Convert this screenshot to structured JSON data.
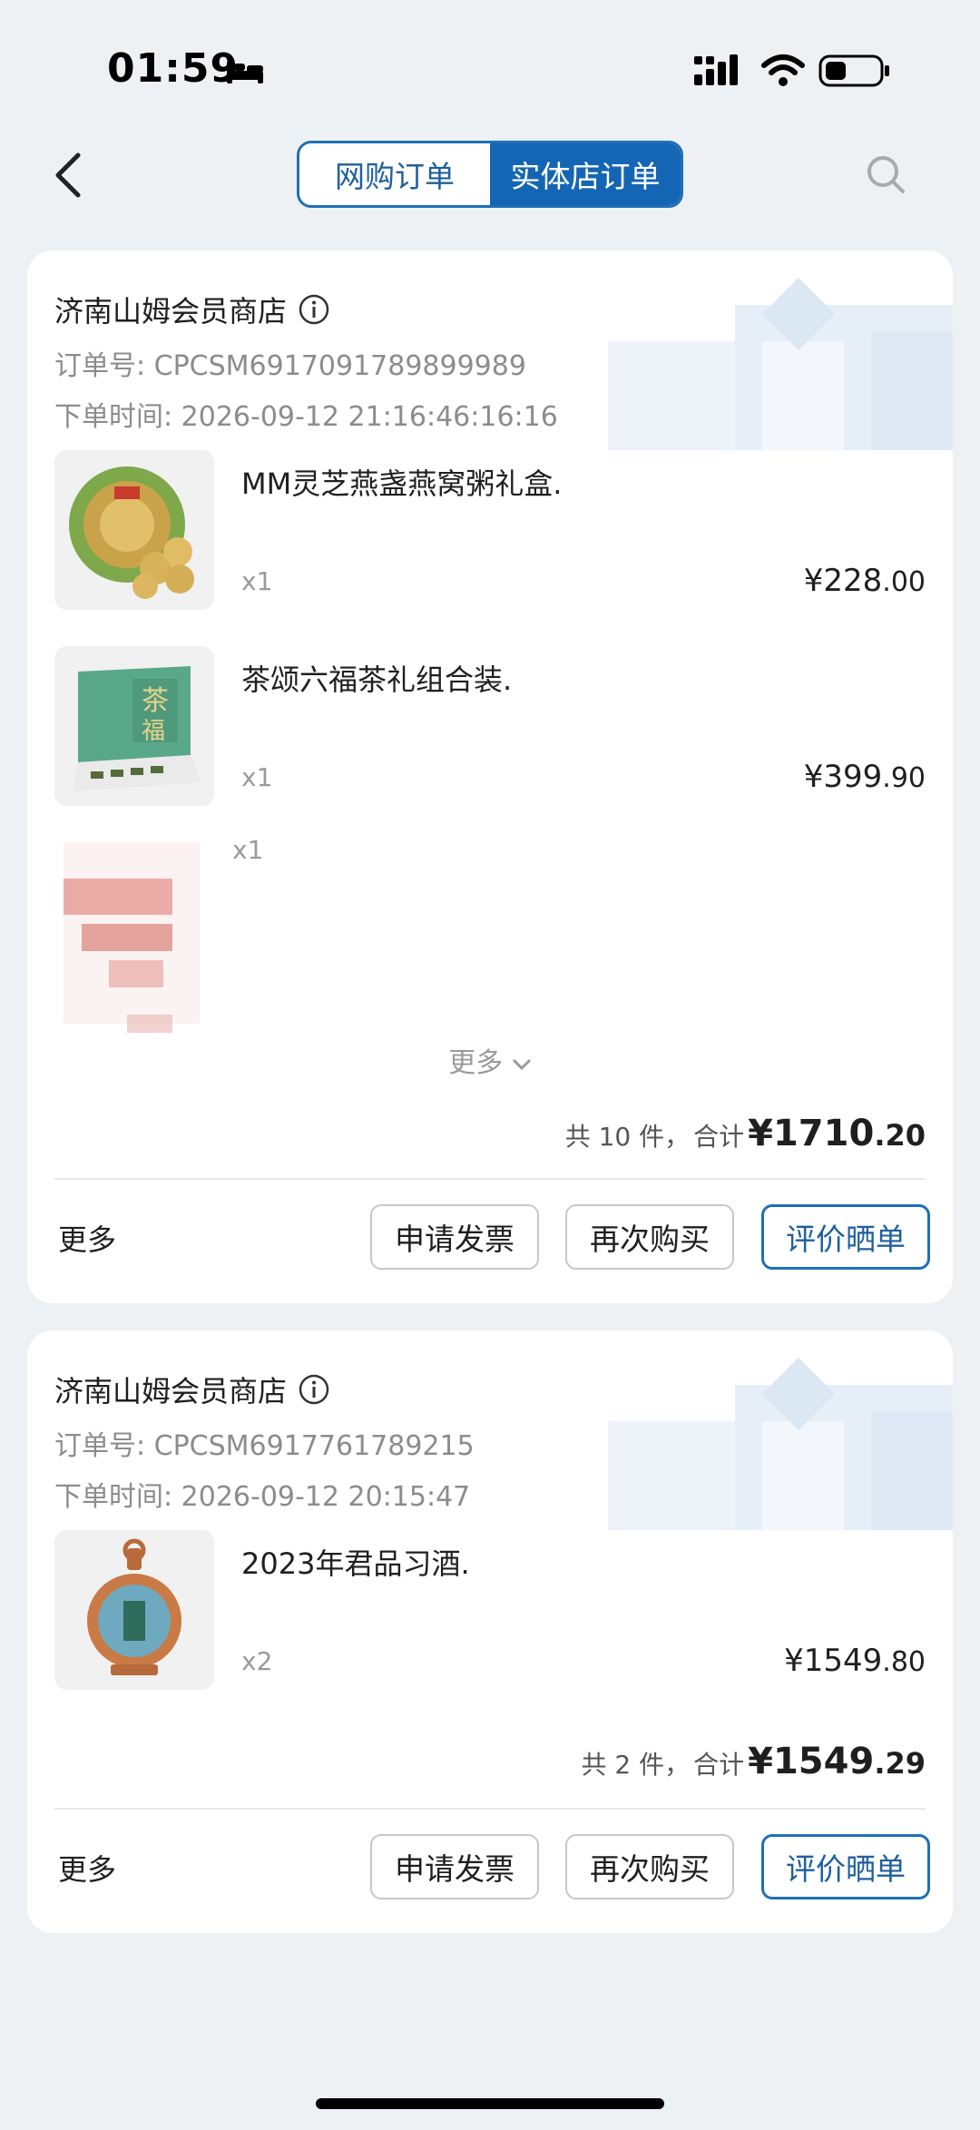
{
  "status_bar": {
    "time": "01:59"
  },
  "header": {
    "tabs": [
      {
        "label": "网购订单",
        "active": false
      },
      {
        "label": "实体店订单",
        "active": true
      }
    ]
  },
  "orders": [
    {
      "store_name": "济南山姆会员商店",
      "order_no": "订单号: CPCSM6917091789899989",
      "order_time": "下单时间: 2026-09-12 21:16:46:16:16",
      "items": [
        {
          "name": "MM灵芝燕盏燕窝粥礼盒.",
          "qty": "x1",
          "price_int": "¥228",
          "price_dec": ".00"
        },
        {
          "name": "茶颂六福茶礼组合装.",
          "qty": "x1",
          "price_int": "¥399",
          "price_dec": ".90"
        }
      ],
      "blurred_item_qty": "x1",
      "more_toggle": "更多",
      "summary_count": "共 10 件，",
      "summary_label": "合计",
      "total_int": "¥1710",
      "total_dec": ".20",
      "more_label": "更多",
      "btn_invoice": "申请发票",
      "btn_rebuy": "再次购买",
      "btn_review": "评价晒单"
    },
    {
      "store_name": "济南山姆会员商店",
      "order_no": "订单号: CPCSM6917761789215",
      "order_time": "下单时间: 2026-09-12 20:15:47",
      "items": [
        {
          "name": "2023年君品习酒.",
          "qty": "x2",
          "price_int": "¥1549",
          "price_dec": ".80"
        }
      ],
      "summary_count": "共 2 件，",
      "summary_label": "合计",
      "total_int": "¥1549",
      "total_dec": ".29",
      "more_label": "更多",
      "btn_invoice": "申请发票",
      "btn_rebuy": "再次购买",
      "btn_review": "评价晒单"
    }
  ],
  "colors": {
    "accent": "#1466b4",
    "background": "#eef1f4"
  }
}
